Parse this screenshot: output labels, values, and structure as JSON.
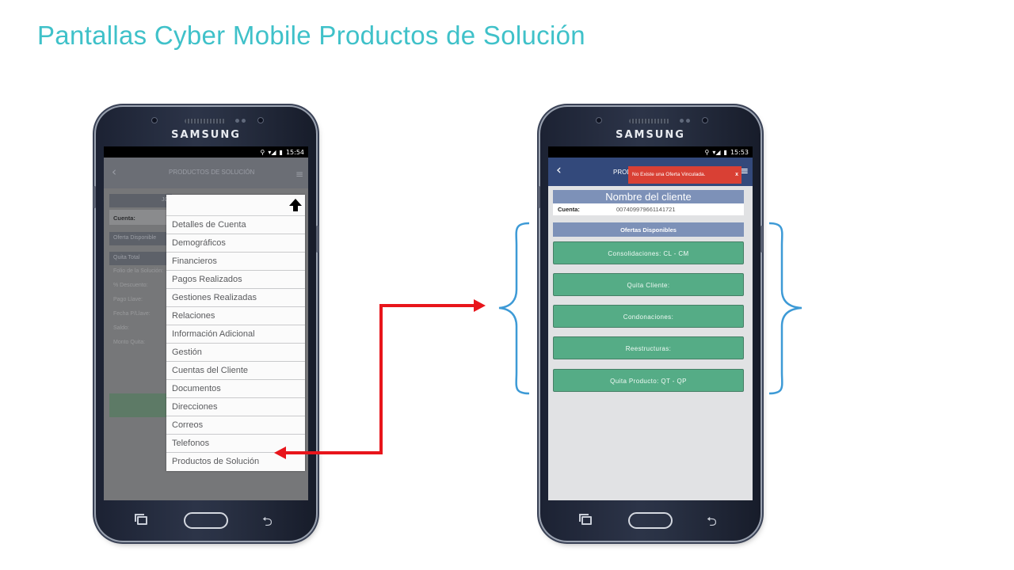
{
  "slide": {
    "title": "Pantallas Cyber Mobile Productos de Solución"
  },
  "device": {
    "brand": "SAMSUNG"
  },
  "left_screen": {
    "status_time": "15:54",
    "header_title": "PRODUCTOS DE SOLUCIÓN",
    "background": {
      "bar_top": "JO",
      "cuenta_label": "Cuenta:",
      "oferta_label": "Oferta Disponible",
      "quita_label": "Quita Total",
      "fields": [
        "Folio de la Solución:",
        "% Descuento:",
        "Pago Llave:",
        "Fecha P/Llave:",
        "Saldo:",
        "Monto Quita:"
      ]
    },
    "menu_items": [
      "Detalles de Cuenta",
      "Demográficos",
      "Financieros",
      "Pagos Realizados",
      "Gestiones Realizadas",
      "Relaciones",
      "Información Adicional",
      "Gestión",
      "Cuentas del Cliente",
      "Documentos",
      "Direcciones",
      "Correos",
      "Telefonos",
      "Productos de Solución"
    ]
  },
  "right_screen": {
    "status_time": "15:53",
    "header_title": "PROD",
    "toast": {
      "message": "No Existe una Oferta Vinculada.",
      "close": "x"
    },
    "client_name": "Nombre del cliente",
    "cuenta_label": "Cuenta:",
    "cuenta_value": "007409979661141721",
    "offers_title": "Ofertas Disponibles",
    "offers": [
      "Consolidaciones: CL - CM",
      "Quita Cliente:",
      "Condonaciones:",
      "Reestructuras:",
      "Quita Producto: QT - QP"
    ]
  },
  "colors": {
    "title": "#3fc1c9",
    "arrow": "#e8151b",
    "brace": "#3d9ad6",
    "header_blue": "#33497b",
    "offer_green": "#55ac86",
    "toast_red": "#d94034"
  }
}
